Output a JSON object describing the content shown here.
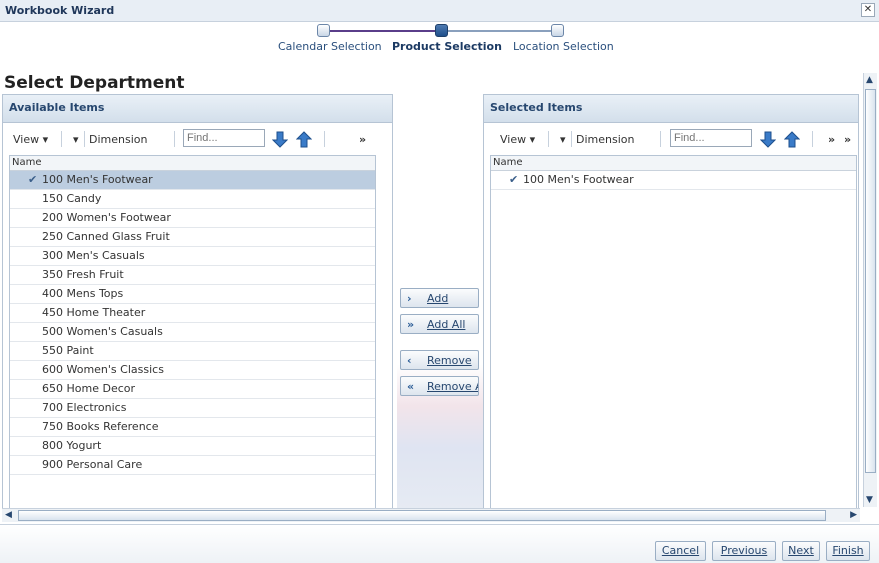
{
  "window": {
    "title": "Workbook Wizard",
    "close": "✕"
  },
  "train": {
    "steps": [
      {
        "label": "Calendar Selection"
      },
      {
        "label": "Product Selection"
      },
      {
        "label": "Location Selection"
      }
    ]
  },
  "page_title": "Select Department",
  "available": {
    "header": "Available Items",
    "toolbar": {
      "view": "View",
      "dimension": "Dimension",
      "find_placeholder": "Find...",
      "more": "»"
    },
    "column": "Name",
    "items": [
      "100 Men's Footwear",
      "150 Candy",
      "200 Women's Footwear",
      "250 Canned Glass Fruit",
      "300 Men's Casuals",
      "350 Fresh Fruit",
      "400 Mens Tops",
      "450 Home Theater",
      "500 Women's Casuals",
      "550 Paint",
      "600 Women's Classics",
      "650 Home Decor",
      "700 Electronics",
      "750 Books Reference",
      "800 Yogurt",
      "900 Personal Care"
    ]
  },
  "selected": {
    "header": "Selected Items",
    "toolbar": {
      "view": "View",
      "dimension": "Dimension",
      "find_placeholder": "Find...",
      "more": "»",
      "more2": "»"
    },
    "column": "Name",
    "items": [
      "100 Men's Footwear"
    ]
  },
  "shuttle": {
    "add": "Add",
    "add_all": "Add All",
    "remove": "Remove",
    "remove_all": "Remove Al"
  },
  "footer": {
    "cancel": "Cancel",
    "previous": "Previous",
    "next": "Next",
    "finish": "Finish"
  }
}
